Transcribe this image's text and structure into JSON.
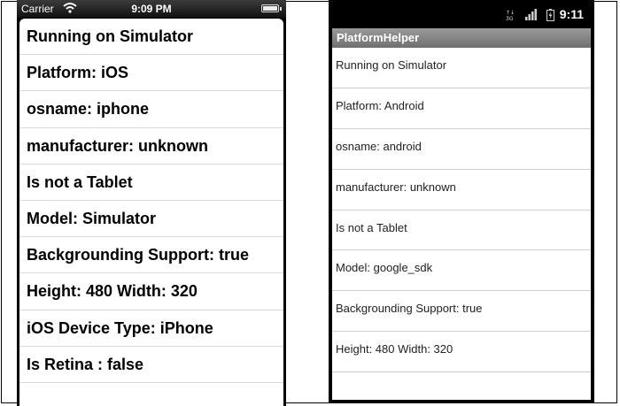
{
  "ios": {
    "status": {
      "carrier": "Carrier",
      "time": "9:09 PM",
      "wifi_icon": "wifi-icon",
      "battery_icon": "battery-icon"
    },
    "rows": [
      "Running on Simulator",
      "Platform: iOS",
      "osname: iphone",
      "manufacturer: unknown",
      "Is not a Tablet",
      "Model: Simulator",
      "Backgrounding Support: true",
      "Height: 480 Width: 320",
      "iOS Device Type: iPhone",
      "Is Retina : false"
    ]
  },
  "android": {
    "status": {
      "time": "9:11",
      "icons": [
        "network-3g-icon",
        "signal-icon",
        "battery-charging-icon"
      ]
    },
    "title": "PlatformHelper",
    "rows": [
      "Running on Simulator",
      "Platform: Android",
      "osname: android",
      "manufacturer: unknown",
      "Is not a Tablet",
      "Model: google_sdk",
      "Backgrounding Support: true",
      "Height: 480 Width: 320"
    ]
  }
}
